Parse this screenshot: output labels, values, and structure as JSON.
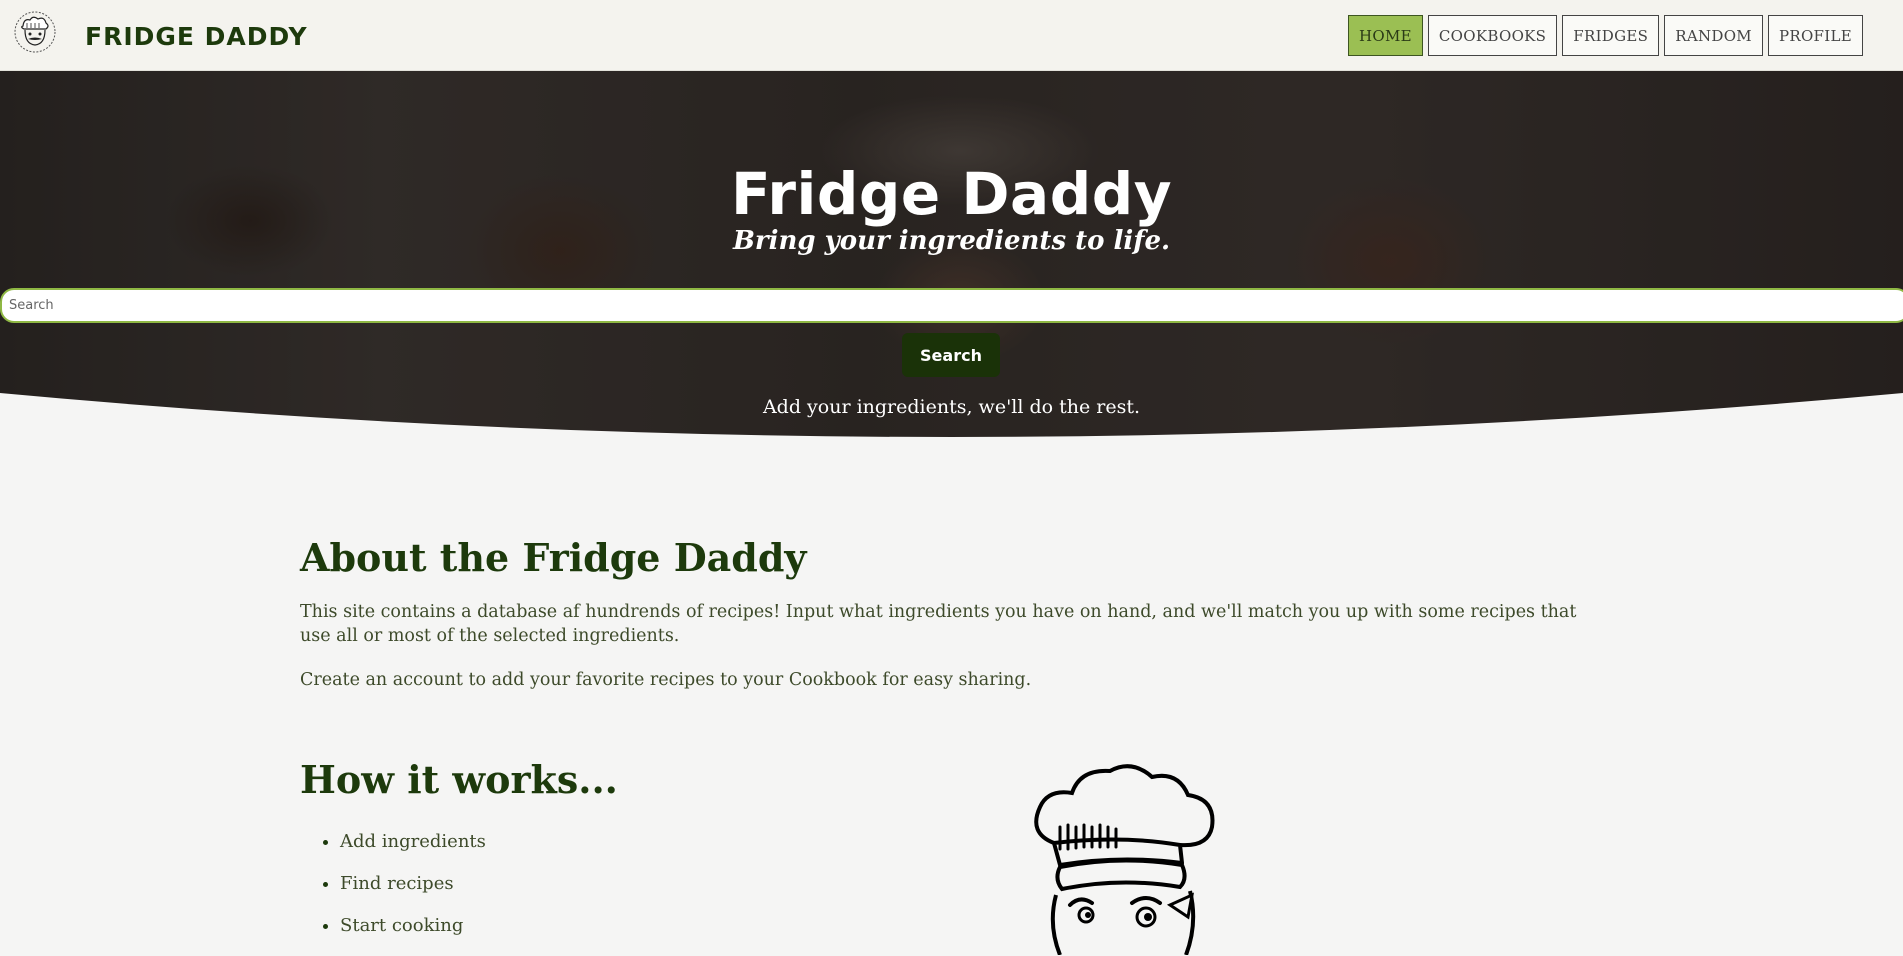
{
  "navbar": {
    "brand": "FRIDGE DADDY",
    "logo_icon": "chef-face-icon",
    "links": [
      {
        "label": "HOME",
        "active": true
      },
      {
        "label": "COOKBOOKS",
        "active": false
      },
      {
        "label": "FRIDGES",
        "active": false
      },
      {
        "label": "RANDOM",
        "active": false
      },
      {
        "label": "PROFILE",
        "active": false
      }
    ],
    "active_color": "#9bbf53"
  },
  "hero": {
    "title": "Fridge Daddy",
    "subtitle": "Bring your ingredients to life.",
    "search_placeholder": "Search",
    "search_value": "",
    "search_button": "Search",
    "tagline": "Add your ingredients, we'll do the rest."
  },
  "about": {
    "title": "About the Fridge Daddy",
    "paragraph1": "This site contains a database af hundrends of recipes! Input what ingredients you have on hand, and we'll match you up with some recipes that use all or most of the selected ingredients.",
    "paragraph2": "Create an account to add your favorite recipes to your Cookbook for easy sharing."
  },
  "how_it_works": {
    "title": "How it works...",
    "steps": [
      "Add ingredients",
      "Find recipes",
      "Start cooking"
    ]
  },
  "colors": {
    "brand_dark_green": "#1d3a0c",
    "accent_green": "#9bbf53",
    "button_green": "#1a3208"
  }
}
